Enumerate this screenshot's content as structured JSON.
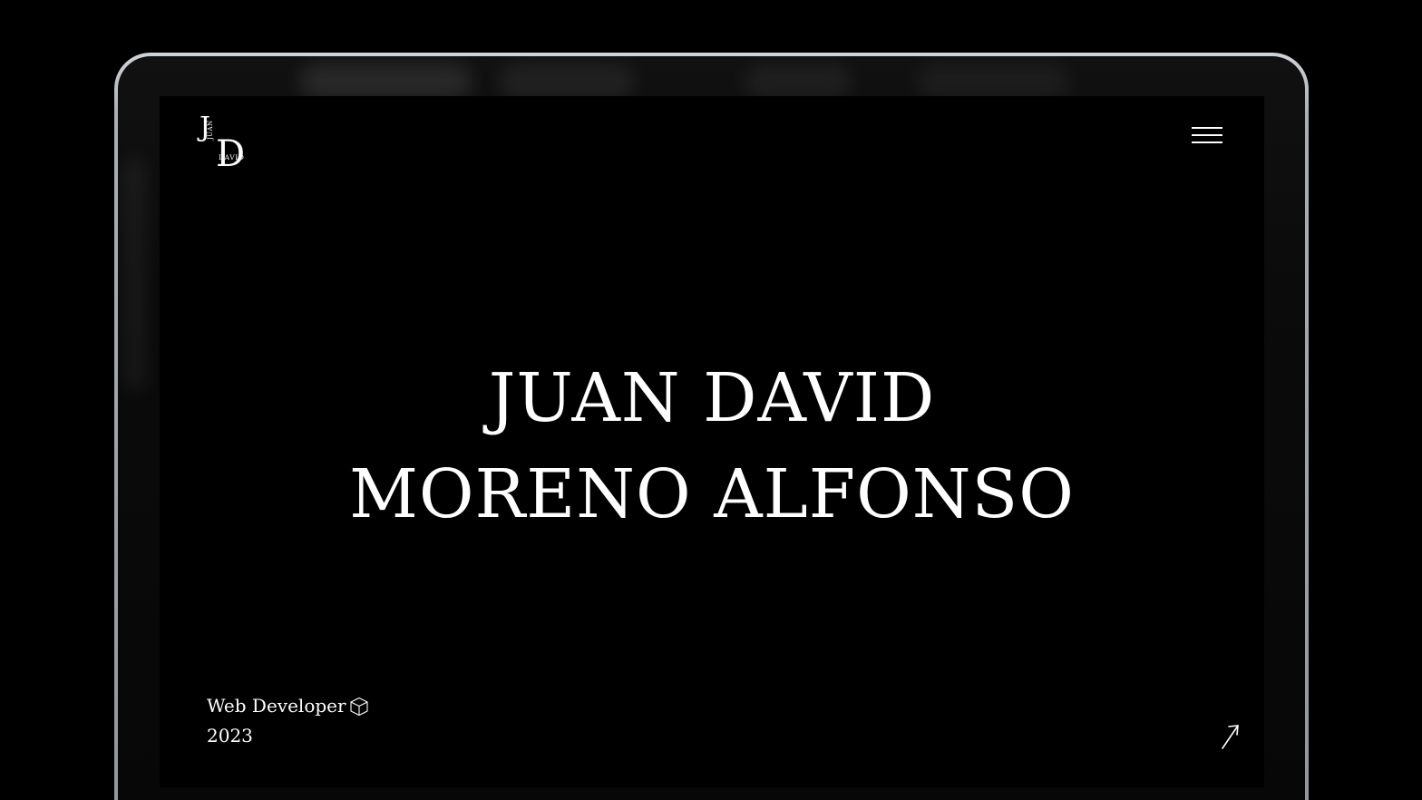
{
  "logo": {
    "initial_first": "J",
    "first_name_small": "JUAN",
    "initial_second": "D",
    "second_name_small": "DAVID"
  },
  "menu": {
    "icon": "hamburger-menu-icon"
  },
  "hero": {
    "line1": "JUAN DAVID",
    "line2": "MORENO ALFONSO"
  },
  "footer": {
    "role": "Web Developer",
    "role_icon": "cube-icon",
    "year": "2023"
  },
  "link": {
    "icon": "arrow-up-right-icon"
  },
  "colors": {
    "background": "#000000",
    "text": "#ffffff",
    "bezel_rim": "#b5bcc1"
  }
}
